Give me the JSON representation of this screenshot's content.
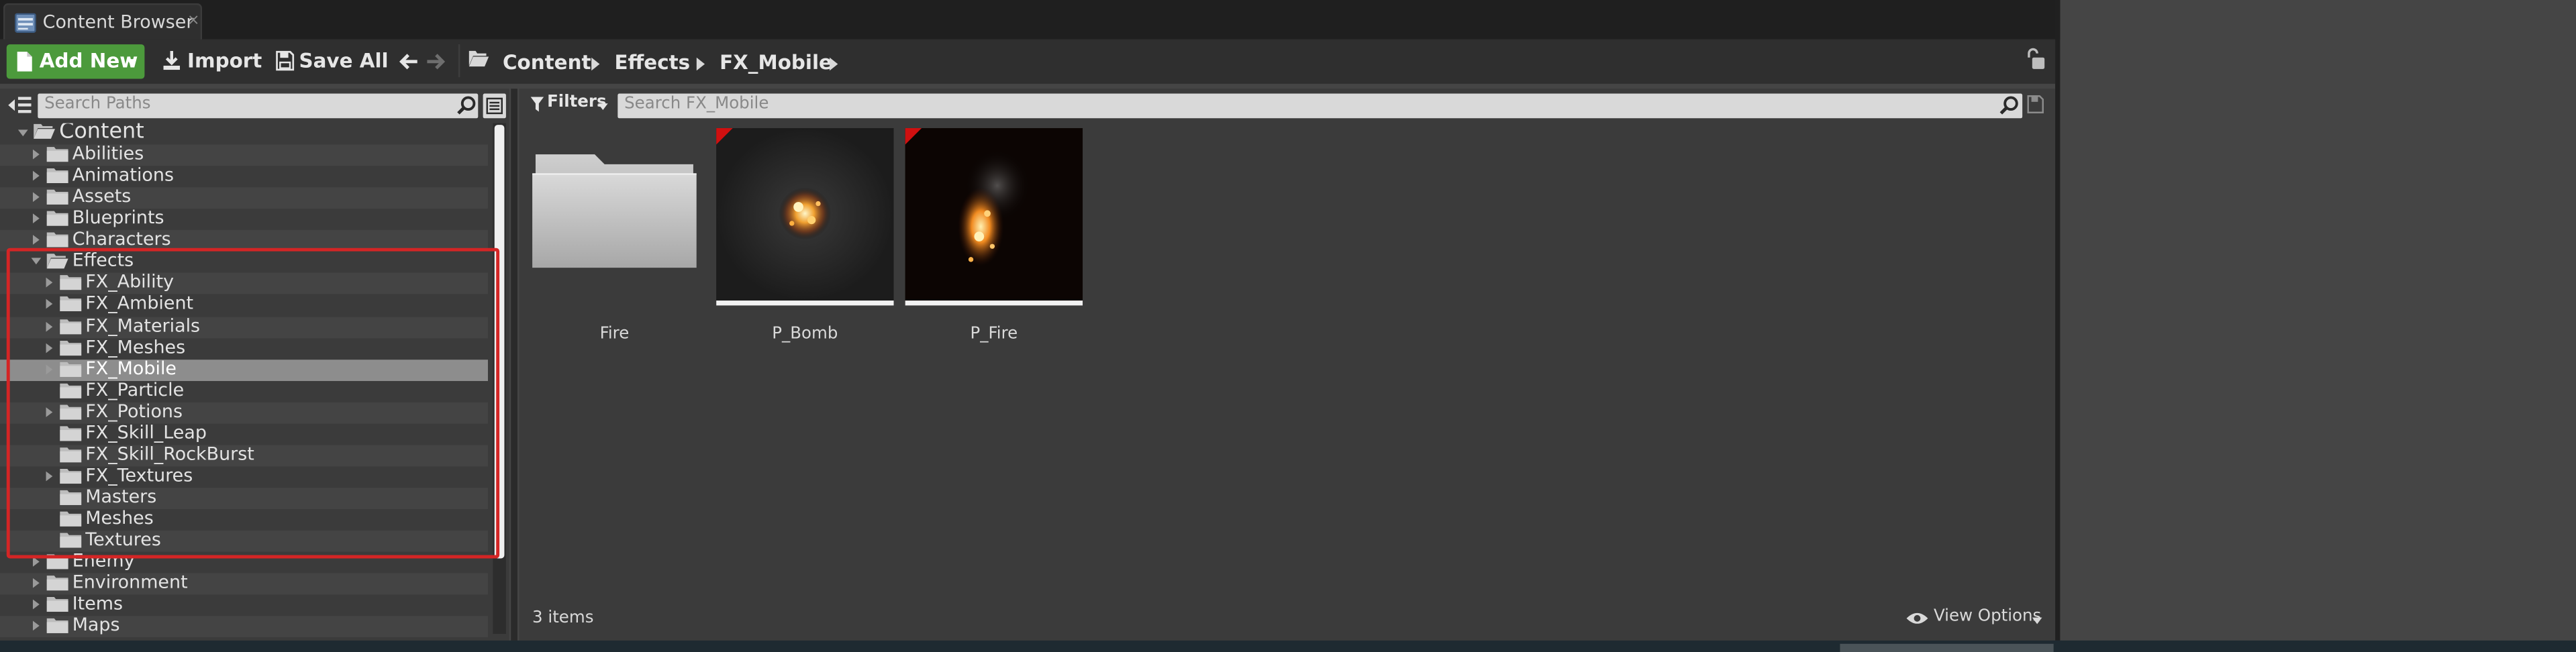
{
  "tab": {
    "label": "Content Browser",
    "close": "×"
  },
  "toolbar": {
    "add_new": "Add New",
    "import": "Import",
    "save_all": "Save All"
  },
  "breadcrumb": [
    "Content",
    "Effects",
    "FX_Mobile"
  ],
  "left": {
    "search_placeholder": "Search Paths",
    "tree": [
      {
        "label": "Content",
        "level": 0,
        "state": "open",
        "root": true
      },
      {
        "label": "Abilities",
        "level": 1,
        "state": "closed"
      },
      {
        "label": "Animations",
        "level": 1,
        "state": "closed"
      },
      {
        "label": "Assets",
        "level": 1,
        "state": "closed"
      },
      {
        "label": "Blueprints",
        "level": 1,
        "state": "closed"
      },
      {
        "label": "Characters",
        "level": 1,
        "state": "closed"
      },
      {
        "label": "Effects",
        "level": 1,
        "state": "open"
      },
      {
        "label": "FX_Ability",
        "level": 2,
        "state": "closed"
      },
      {
        "label": "FX_Ambient",
        "level": 2,
        "state": "closed"
      },
      {
        "label": "FX_Materials",
        "level": 2,
        "state": "closed"
      },
      {
        "label": "FX_Meshes",
        "level": 2,
        "state": "closed"
      },
      {
        "label": "FX_Mobile",
        "level": 2,
        "state": "closed",
        "selected": true
      },
      {
        "label": "FX_Particle",
        "level": 2,
        "state": "leaf"
      },
      {
        "label": "FX_Potions",
        "level": 2,
        "state": "closed"
      },
      {
        "label": "FX_Skill_Leap",
        "level": 2,
        "state": "leaf"
      },
      {
        "label": "FX_Skill_RockBurst",
        "level": 2,
        "state": "leaf"
      },
      {
        "label": "FX_Textures",
        "level": 2,
        "state": "closed"
      },
      {
        "label": "Masters",
        "level": 2,
        "state": "leaf"
      },
      {
        "label": "Meshes",
        "level": 2,
        "state": "leaf"
      },
      {
        "label": "Textures",
        "level": 2,
        "state": "leaf"
      },
      {
        "label": "Enemy",
        "level": 1,
        "state": "closed"
      },
      {
        "label": "Environment",
        "level": 1,
        "state": "closed"
      },
      {
        "label": "Items",
        "level": 1,
        "state": "closed"
      },
      {
        "label": "Maps",
        "level": 1,
        "state": "closed"
      }
    ]
  },
  "right": {
    "filters_label": "Filters",
    "search_placeholder": "Search FX_Mobile",
    "assets": [
      {
        "name": "Fire",
        "type": "folder"
      },
      {
        "name": "P_Bomb",
        "type": "particle"
      },
      {
        "name": "P_Fire",
        "type": "particle"
      }
    ],
    "item_count": "3 items",
    "view_options": "View Options"
  },
  "colors": {
    "add_new_bg": "#4c9a3c",
    "selection_bg": "#8d8d8d",
    "highlight_border": "#d42525",
    "asset_flag": "#d01010"
  }
}
